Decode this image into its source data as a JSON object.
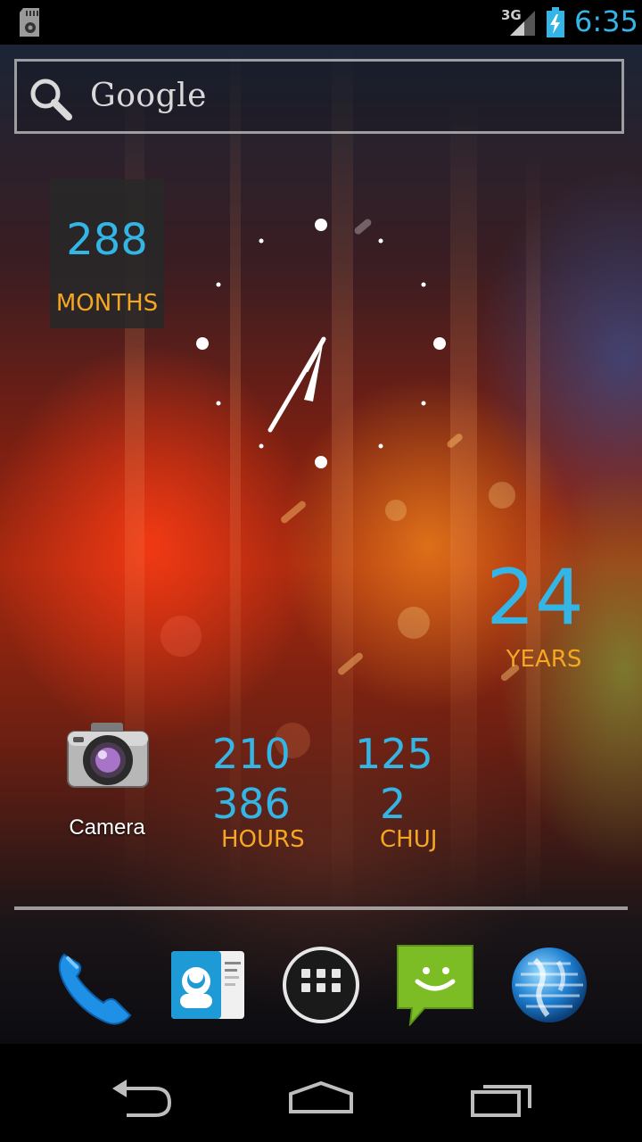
{
  "status_bar": {
    "network": "3G",
    "time": "6:35",
    "icons": [
      "sdcard-icon",
      "signal-icon",
      "battery-charging-icon"
    ]
  },
  "search": {
    "logo_text": "Google",
    "icon": "search-icon"
  },
  "widgets": {
    "months": {
      "value": "288",
      "label": "MONTHS"
    },
    "years": {
      "value": "24",
      "label": "YEARS"
    },
    "hours": {
      "value1": "210",
      "value2": "386",
      "label": "HOURS"
    },
    "chuj": {
      "value1": "125",
      "value2": "2",
      "label": "CHUJ"
    }
  },
  "apps": {
    "camera": {
      "label": "Camera",
      "icon": "camera-icon"
    }
  },
  "dock": [
    "phone-icon",
    "contacts-icon",
    "app-drawer-icon",
    "messaging-icon",
    "browser-icon"
  ],
  "navigation": [
    "back-icon",
    "home-icon",
    "recent-apps-icon"
  ],
  "colors": {
    "accent_blue": "#33b5e5",
    "accent_orange": "#f5a623"
  }
}
